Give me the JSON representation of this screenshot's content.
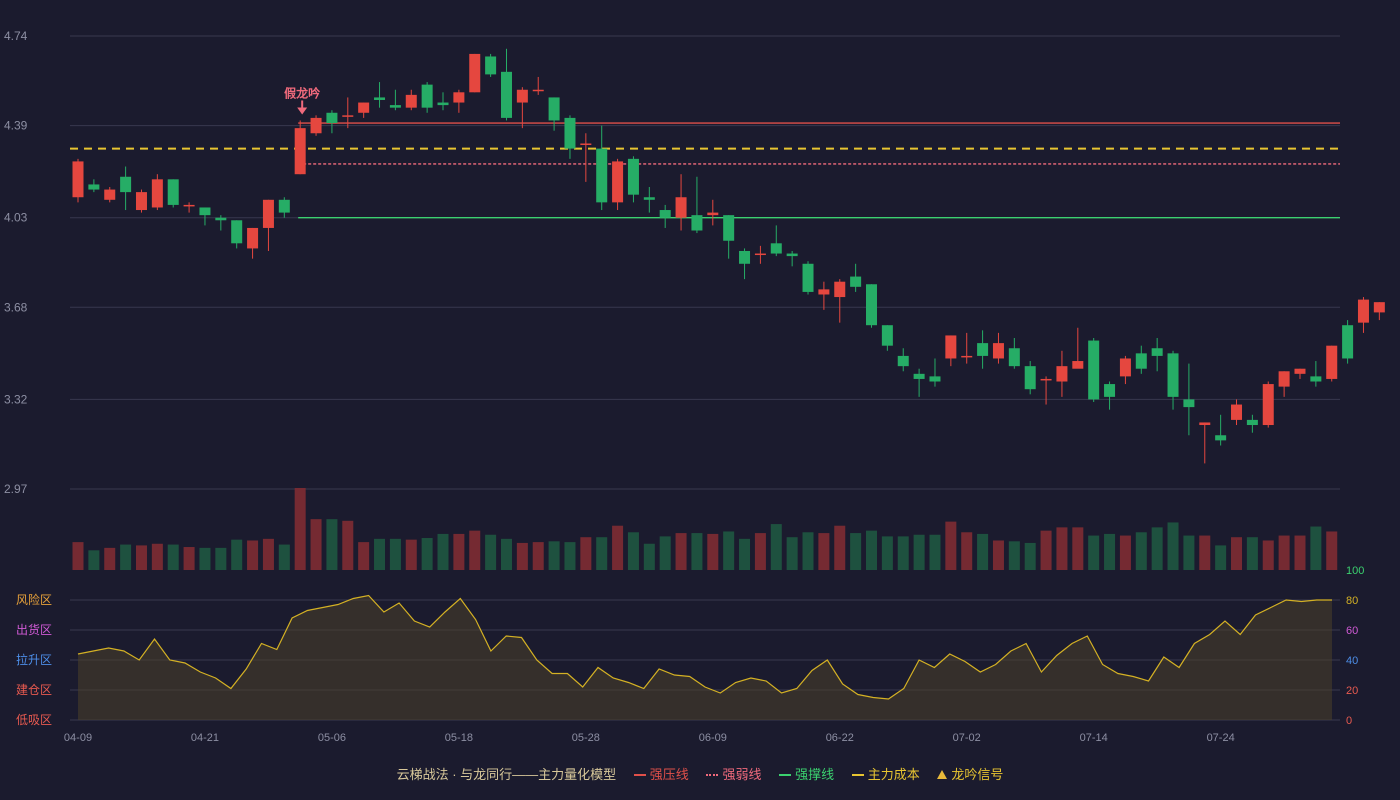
{
  "chart_data": {
    "type": "candlestick",
    "price_axis": {
      "ticks": [
        4.74,
        4.39,
        4.03,
        3.68,
        3.32,
        2.97
      ],
      "range": [
        2.97,
        4.74
      ]
    },
    "x_tick_labels": [
      {
        "label": "04-09",
        "index": 0
      },
      {
        "label": "04-21",
        "index": 8
      },
      {
        "label": "05-06",
        "index": 16
      },
      {
        "label": "05-18",
        "index": 24
      },
      {
        "label": "05-28",
        "index": 32
      },
      {
        "label": "06-09",
        "index": 40
      },
      {
        "label": "06-22",
        "index": 48
      },
      {
        "label": "07-02",
        "index": 56
      },
      {
        "label": "07-14",
        "index": 64
      },
      {
        "label": "07-24",
        "index": 72
      }
    ],
    "candles": [
      [
        4.11,
        4.25,
        4.26,
        4.09
      ],
      [
        4.16,
        4.14,
        4.18,
        4.13
      ],
      [
        4.1,
        4.14,
        4.15,
        4.09
      ],
      [
        4.19,
        4.13,
        4.23,
        4.06
      ],
      [
        4.06,
        4.13,
        4.14,
        4.05
      ],
      [
        4.07,
        4.18,
        4.2,
        4.06
      ],
      [
        4.18,
        4.08,
        4.18,
        4.07
      ],
      [
        4.08,
        4.08,
        4.09,
        4.05
      ],
      [
        4.07,
        4.04,
        4.07,
        4.0
      ],
      [
        4.03,
        4.02,
        4.04,
        3.98
      ],
      [
        4.02,
        3.93,
        4.02,
        3.91
      ],
      [
        3.91,
        3.99,
        3.99,
        3.87
      ],
      [
        3.99,
        4.1,
        4.1,
        3.9
      ],
      [
        4.1,
        4.05,
        4.11,
        4.03
      ],
      [
        4.2,
        4.38,
        4.41,
        4.2
      ],
      [
        4.36,
        4.42,
        4.43,
        4.35
      ],
      [
        4.44,
        4.4,
        4.45,
        4.36
      ],
      [
        4.43,
        4.43,
        4.5,
        4.38
      ],
      [
        4.44,
        4.48,
        4.48,
        4.42
      ],
      [
        4.5,
        4.49,
        4.56,
        4.46
      ],
      [
        4.47,
        4.46,
        4.53,
        4.45
      ],
      [
        4.46,
        4.51,
        4.53,
        4.45
      ],
      [
        4.55,
        4.46,
        4.56,
        4.44
      ],
      [
        4.48,
        4.47,
        4.52,
        4.45
      ],
      [
        4.48,
        4.52,
        4.53,
        4.44
      ],
      [
        4.52,
        4.67,
        4.67,
        4.52
      ],
      [
        4.66,
        4.59,
        4.67,
        4.58
      ],
      [
        4.6,
        4.42,
        4.69,
        4.41
      ],
      [
        4.48,
        4.53,
        4.54,
        4.38
      ],
      [
        4.53,
        4.53,
        4.58,
        4.51
      ],
      [
        4.5,
        4.41,
        4.5,
        4.37
      ],
      [
        4.42,
        4.3,
        4.43,
        4.26
      ],
      [
        4.32,
        4.32,
        4.36,
        4.17
      ],
      [
        4.3,
        4.09,
        4.39,
        4.06
      ],
      [
        4.09,
        4.25,
        4.26,
        4.06
      ],
      [
        4.26,
        4.12,
        4.27,
        4.09
      ],
      [
        4.11,
        4.1,
        4.15,
        4.05
      ],
      [
        4.06,
        4.03,
        4.08,
        3.99
      ],
      [
        4.03,
        4.11,
        4.2,
        3.98
      ],
      [
        4.04,
        3.98,
        4.19,
        3.97
      ],
      [
        4.04,
        4.05,
        4.1,
        4.0
      ],
      [
        4.04,
        3.94,
        4.04,
        3.87
      ],
      [
        3.9,
        3.85,
        3.91,
        3.79
      ],
      [
        3.89,
        3.89,
        3.92,
        3.85
      ],
      [
        3.93,
        3.89,
        4.0,
        3.88
      ],
      [
        3.89,
        3.88,
        3.9,
        3.84
      ],
      [
        3.85,
        3.74,
        3.86,
        3.73
      ],
      [
        3.73,
        3.75,
        3.78,
        3.67
      ],
      [
        3.72,
        3.78,
        3.79,
        3.62
      ],
      [
        3.8,
        3.76,
        3.85,
        3.74
      ],
      [
        3.77,
        3.61,
        3.77,
        3.6
      ],
      [
        3.61,
        3.53,
        3.61,
        3.51
      ],
      [
        3.49,
        3.45,
        3.52,
        3.43
      ],
      [
        3.42,
        3.4,
        3.44,
        3.33
      ],
      [
        3.41,
        3.39,
        3.48,
        3.37
      ],
      [
        3.48,
        3.57,
        3.57,
        3.45
      ],
      [
        3.49,
        3.49,
        3.58,
        3.46
      ],
      [
        3.54,
        3.49,
        3.59,
        3.44
      ],
      [
        3.48,
        3.54,
        3.58,
        3.46
      ],
      [
        3.52,
        3.45,
        3.56,
        3.44
      ],
      [
        3.45,
        3.36,
        3.47,
        3.34
      ],
      [
        3.4,
        3.4,
        3.41,
        3.3
      ],
      [
        3.39,
        3.45,
        3.51,
        3.33
      ],
      [
        3.44,
        3.47,
        3.6,
        3.45
      ],
      [
        3.55,
        3.32,
        3.56,
        3.31
      ],
      [
        3.38,
        3.33,
        3.39,
        3.28
      ],
      [
        3.41,
        3.48,
        3.49,
        3.38
      ],
      [
        3.5,
        3.44,
        3.53,
        3.42
      ],
      [
        3.52,
        3.49,
        3.56,
        3.43
      ],
      [
        3.5,
        3.33,
        3.51,
        3.28
      ],
      [
        3.32,
        3.29,
        3.46,
        3.18
      ],
      [
        3.22,
        3.23,
        3.23,
        3.07
      ],
      [
        3.18,
        3.16,
        3.26,
        3.14
      ],
      [
        3.24,
        3.3,
        3.32,
        3.22
      ],
      [
        3.24,
        3.22,
        3.26,
        3.19
      ],
      [
        3.22,
        3.38,
        3.39,
        3.21
      ],
      [
        3.37,
        3.43,
        3.43,
        3.33
      ],
      [
        3.42,
        3.44,
        3.44,
        3.4
      ],
      [
        3.41,
        3.39,
        3.47,
        3.37
      ],
      [
        3.4,
        3.53,
        3.53,
        3.39
      ],
      [
        3.61,
        3.48,
        3.63,
        3.46
      ],
      [
        3.62,
        3.71,
        3.72,
        3.58
      ],
      [
        3.66,
        3.7,
        3.7,
        3.63
      ]
    ],
    "volume": [
      0.34,
      0.24,
      0.27,
      0.31,
      0.3,
      0.32,
      0.31,
      0.28,
      0.27,
      0.27,
      0.37,
      0.36,
      0.38,
      0.31,
      1.0,
      0.62,
      0.62,
      0.6,
      0.34,
      0.38,
      0.38,
      0.37,
      0.39,
      0.44,
      0.44,
      0.48,
      0.43,
      0.38,
      0.33,
      0.34,
      0.35,
      0.34,
      0.4,
      0.4,
      0.54,
      0.46,
      0.32,
      0.41,
      0.45,
      0.45,
      0.44,
      0.47,
      0.38,
      0.45,
      0.56,
      0.4,
      0.46,
      0.45,
      0.54,
      0.45,
      0.48,
      0.41,
      0.41,
      0.43,
      0.43,
      0.59,
      0.46,
      0.44,
      0.36,
      0.35,
      0.33,
      0.48,
      0.52,
      0.52,
      0.42,
      0.44,
      0.42,
      0.46,
      0.52,
      0.58,
      0.42,
      0.42,
      0.3,
      0.4,
      0.4,
      0.36,
      0.42,
      0.42,
      0.53,
      0.47
    ],
    "oscillator": {
      "axis_ticks": [
        100,
        80,
        60,
        40,
        20,
        0
      ],
      "zones": [
        "风险区",
        "出货区",
        "拉升区",
        "建仓区",
        "低吸区"
      ],
      "values": [
        44,
        46,
        48,
        46,
        40,
        54,
        40,
        38,
        32,
        28,
        21,
        34,
        51,
        47,
        68,
        73,
        75,
        77,
        81,
        83,
        72,
        78,
        66,
        62,
        72,
        81,
        67,
        46,
        56,
        55,
        40,
        31,
        31,
        22,
        35,
        28,
        25,
        21,
        34,
        30,
        29,
        22,
        18,
        25,
        28,
        26,
        18,
        21,
        33,
        40,
        24,
        17,
        15,
        14,
        21,
        40,
        35,
        44,
        39,
        32,
        37,
        46,
        51,
        32,
        43,
        51,
        56,
        37,
        31,
        29,
        26,
        42,
        35,
        51,
        57,
        66,
        57,
        70,
        75,
        80,
        79,
        80,
        80
      ]
    },
    "levels": [
      {
        "name": "强压线",
        "value": 4.4,
        "color": "#e0504a",
        "style": "solid",
        "start_index": 14
      },
      {
        "name": "主力成本",
        "value": 4.3,
        "color": "#e8c531",
        "style": "dashed",
        "start_index": 0
      },
      {
        "name": "强弱线",
        "value": 4.24,
        "color": "#f06a7c",
        "style": "dotted",
        "start_index": 14
      },
      {
        "name": "强撑线",
        "value": 4.03,
        "color": "#3bd16f",
        "style": "solid",
        "start_index": 14
      }
    ],
    "signals": [
      {
        "index": 14,
        "label": "假龙吟"
      }
    ],
    "legend_title": "云梯战法 · 与龙同行——主力量化模型",
    "legend": [
      "强压线",
      "强弱线",
      "强撑线",
      "主力成本",
      "龙吟信号"
    ],
    "colors": {
      "up": "#e5473f",
      "down": "#26ad66",
      "avg": "#d4b124",
      "grid": "#38384e",
      "axis_text": "#8d8fa3"
    }
  }
}
